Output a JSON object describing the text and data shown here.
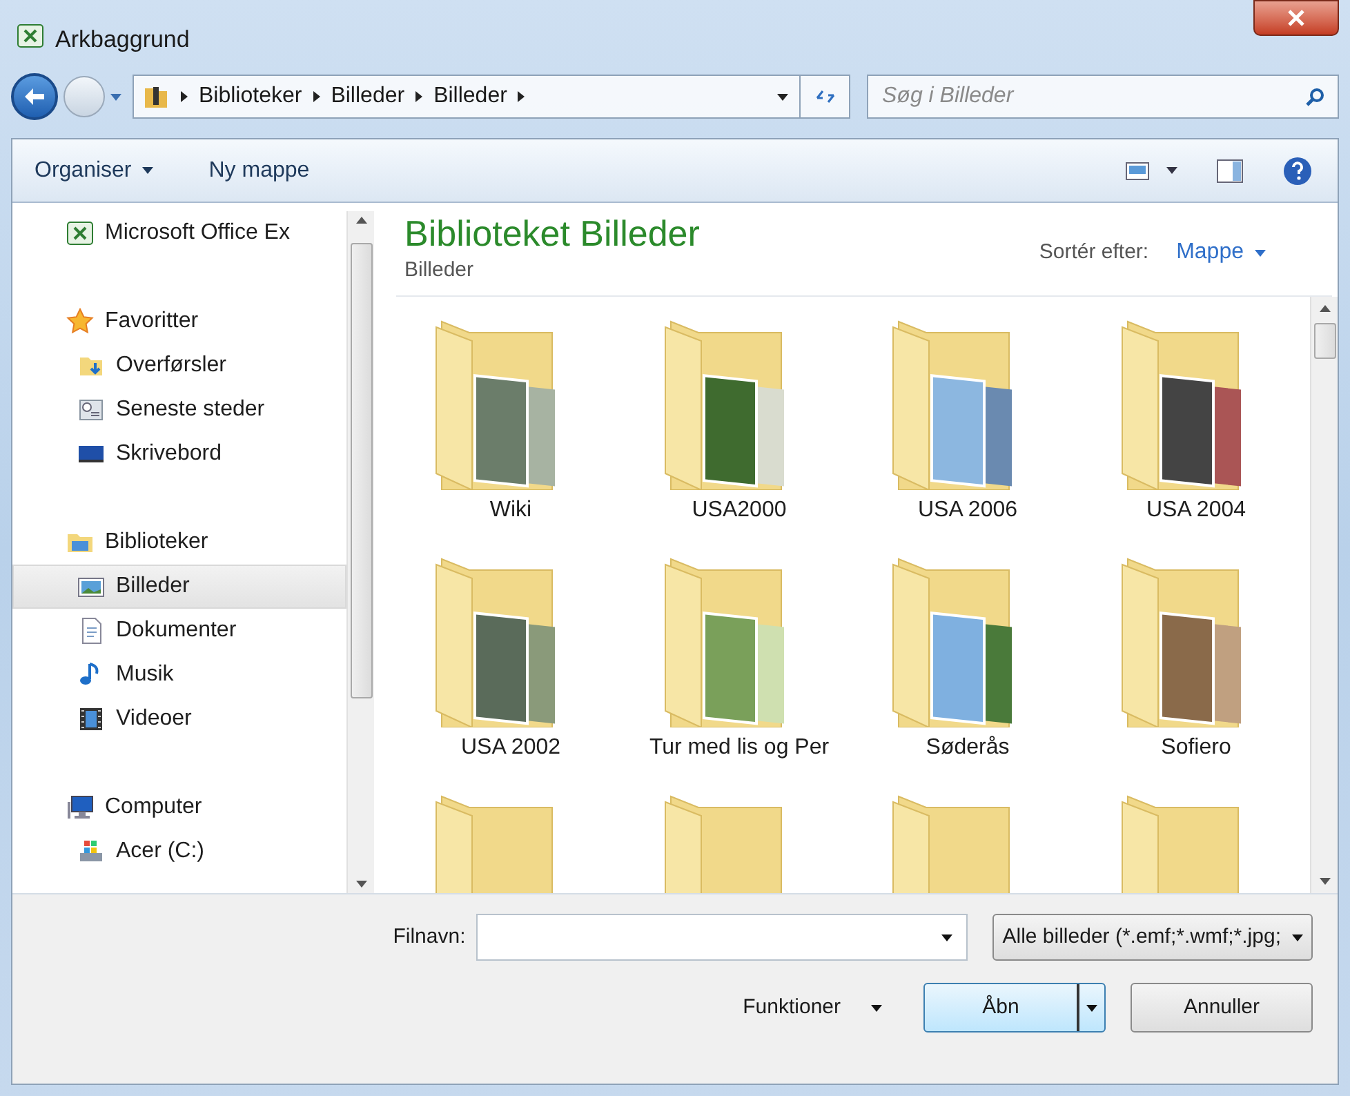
{
  "window": {
    "title": "Arkbaggrund"
  },
  "address_bar": {
    "breadcrumbs": [
      "Biblioteker",
      "Billeder",
      "Billeder"
    ]
  },
  "search": {
    "placeholder": "Søg i Billeder"
  },
  "toolbar": {
    "items": [
      {
        "label": "Organiser",
        "dropdown": true
      },
      {
        "label": "Ny mappe",
        "dropdown": false
      }
    ]
  },
  "sidebar": {
    "items": [
      {
        "label": "Microsoft Office Ex",
        "kind": "excel",
        "selected": false
      },
      {
        "label": "Favoritter",
        "kind": "favorites",
        "selected": false,
        "children": [
          {
            "label": "Overførsler",
            "kind": "downloads",
            "selected": false
          },
          {
            "label": "Seneste steder",
            "kind": "recent",
            "selected": false
          },
          {
            "label": "Skrivebord",
            "kind": "desktop",
            "selected": false
          }
        ]
      },
      {
        "label": "Biblioteker",
        "kind": "libraries",
        "selected": false,
        "children": [
          {
            "label": "Billeder",
            "kind": "pictures",
            "selected": true
          },
          {
            "label": "Dokumenter",
            "kind": "documents",
            "selected": false
          },
          {
            "label": "Musik",
            "kind": "music",
            "selected": false
          },
          {
            "label": "Videoer",
            "kind": "videos",
            "selected": false
          }
        ]
      },
      {
        "label": "Computer",
        "kind": "computer",
        "selected": false,
        "children": [
          {
            "label": "Acer (C:)",
            "kind": "drive",
            "selected": false
          }
        ]
      }
    ]
  },
  "content": {
    "title": "Biblioteket Billeder",
    "subtitle": "Billeder",
    "sort_label": "Sortér efter:",
    "sort_value": "Mappe",
    "folders": [
      {
        "kind": "full",
        "name": "Wiki"
      },
      {
        "kind": "full",
        "name": "USA2000"
      },
      {
        "kind": "full",
        "name": "USA 2006"
      },
      {
        "kind": "full",
        "name": "USA 2004"
      },
      {
        "kind": "full",
        "name": "USA 2002"
      },
      {
        "kind": "full",
        "name": "Tur med lis og Per"
      },
      {
        "kind": "full",
        "name": "Søderås"
      },
      {
        "kind": "full",
        "name": "Sofiero"
      },
      {
        "kind": "partial"
      },
      {
        "kind": "partial"
      },
      {
        "kind": "partial"
      },
      {
        "kind": "partial"
      }
    ]
  },
  "footer": {
    "filename_label": "Filnavn:",
    "filetype": "Alle billeder (*.emf;*.wmf;*.jpg;",
    "tools": "Funktioner",
    "open_button": "Åbn",
    "cancel_button": "Annuller"
  }
}
